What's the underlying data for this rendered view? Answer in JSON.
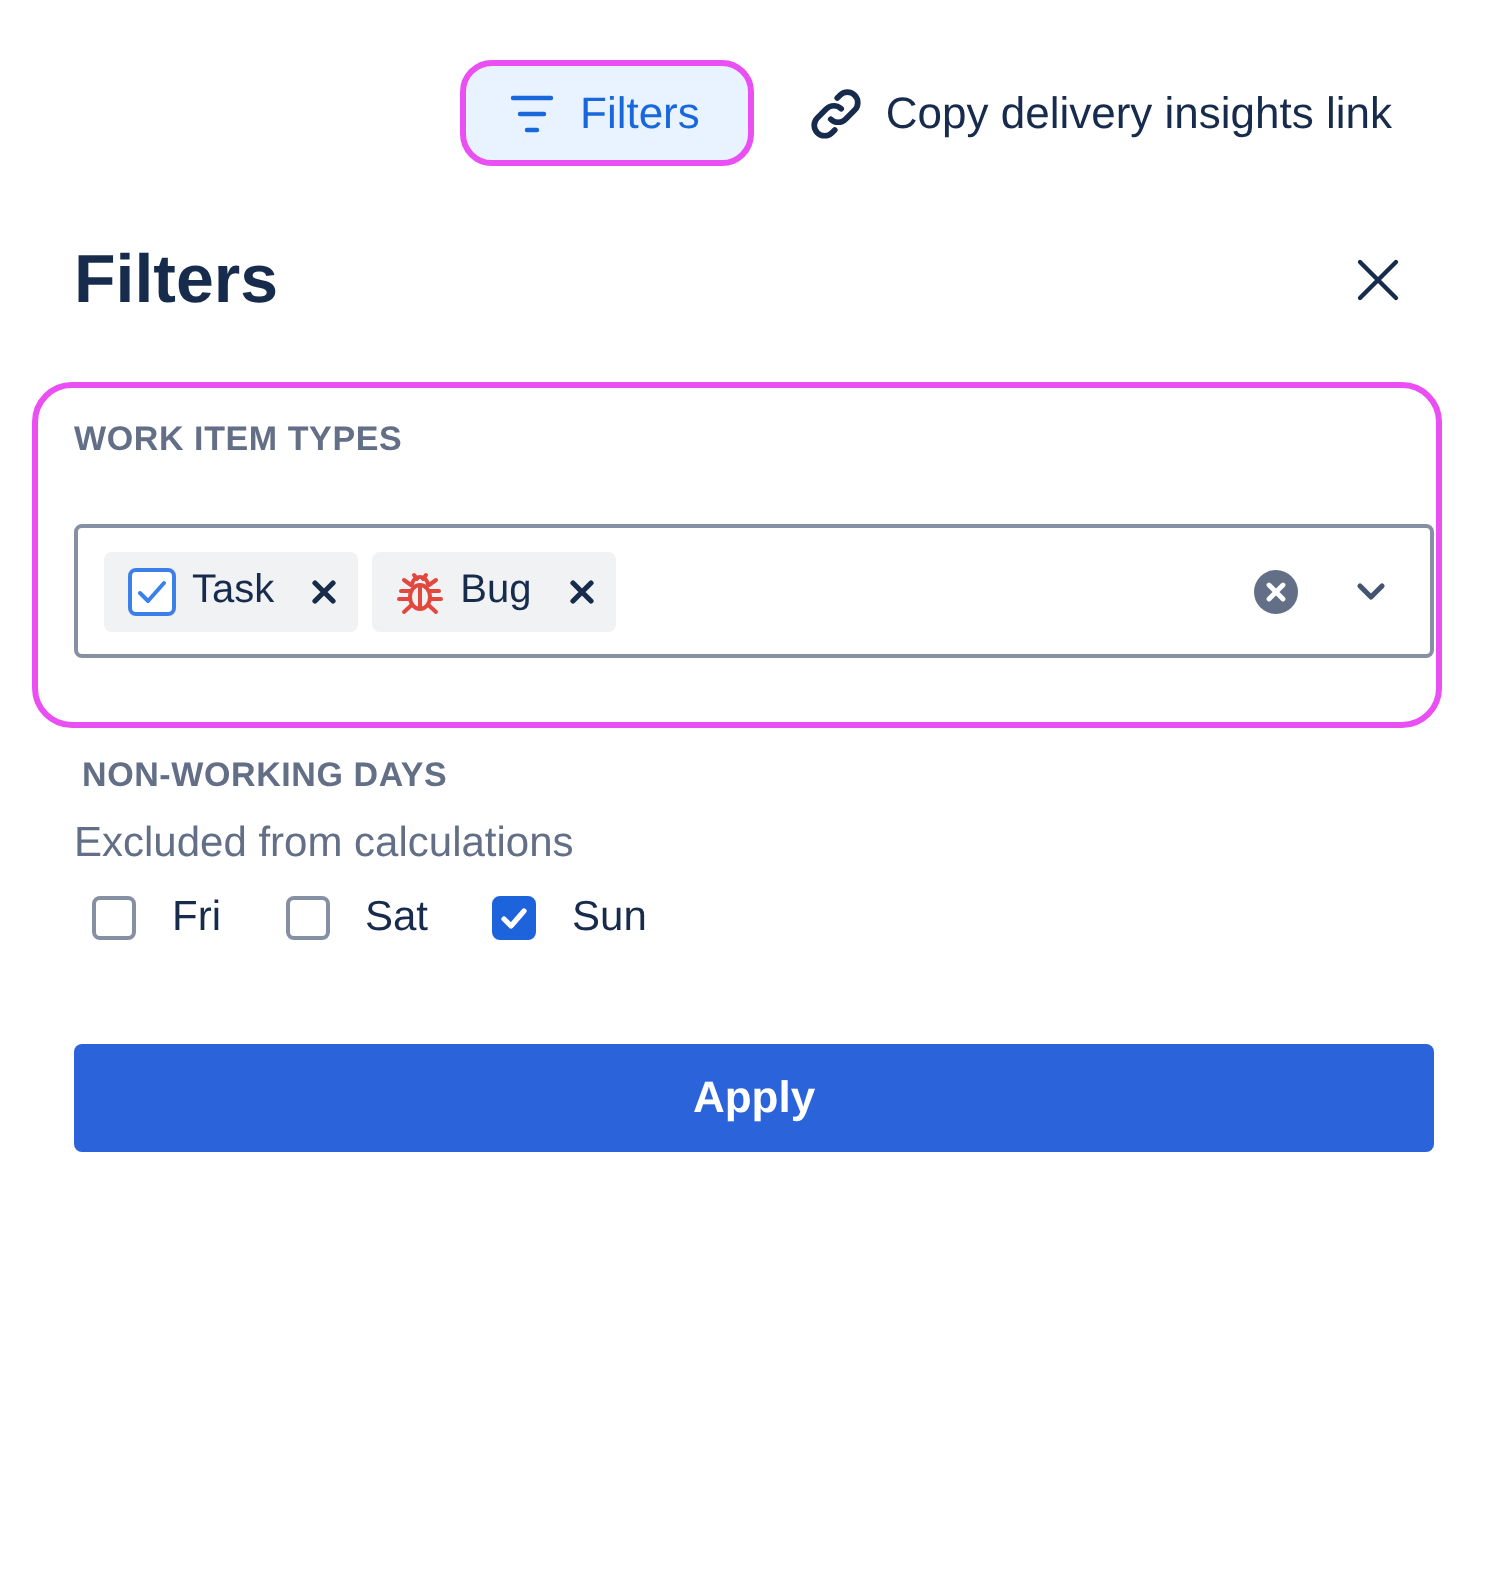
{
  "toolbar": {
    "filters_button": {
      "label": "Filters",
      "highlighted": true
    },
    "copy_link": {
      "label": "Copy delivery insights link"
    }
  },
  "panel": {
    "title": "Filters"
  },
  "work_item_types": {
    "label": "WORK ITEM TYPES",
    "highlighted": true,
    "tags": [
      {
        "kind": "task",
        "label": "Task"
      },
      {
        "kind": "bug",
        "label": "Bug"
      }
    ]
  },
  "non_working_days": {
    "label": "NON-WORKING DAYS",
    "description": "Excluded from calculations",
    "days": [
      {
        "label": "Fri",
        "checked": false
      },
      {
        "label": "Sat",
        "checked": false
      },
      {
        "label": "Sun",
        "checked": true
      }
    ]
  },
  "apply_button": {
    "label": "Apply"
  }
}
